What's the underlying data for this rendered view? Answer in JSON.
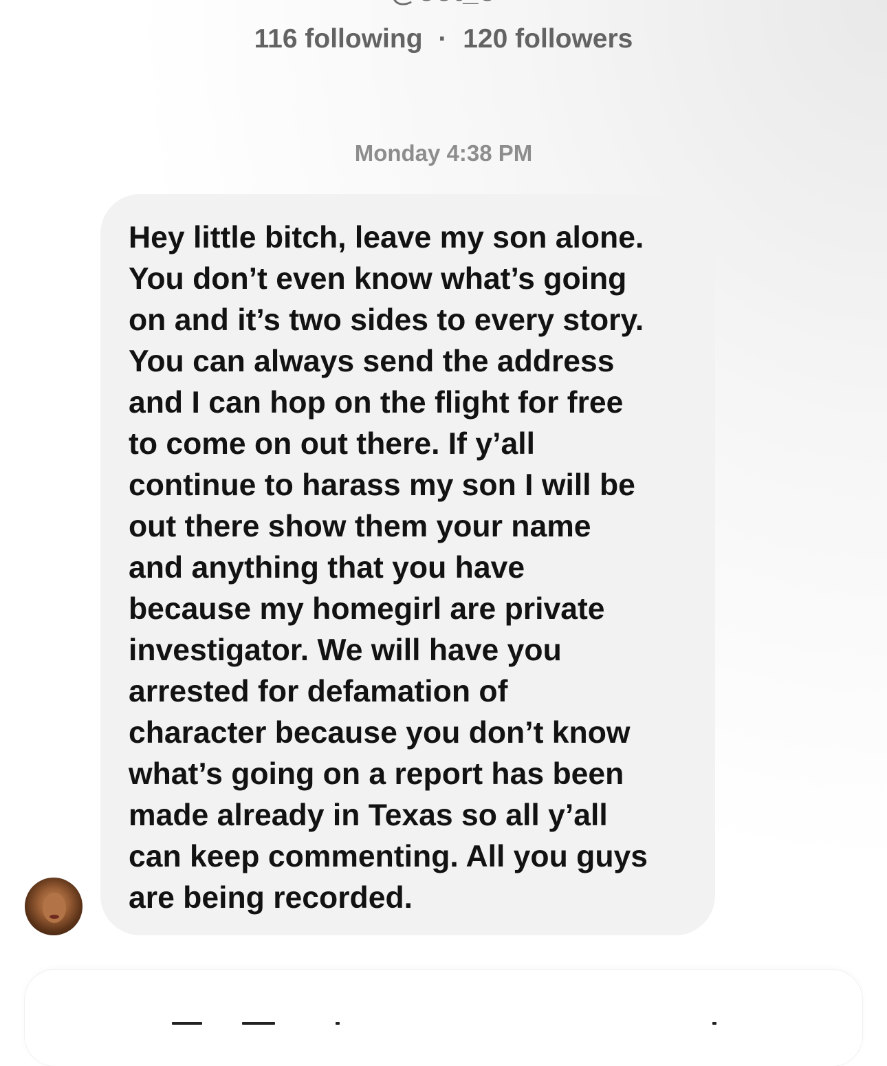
{
  "profile": {
    "handle": "@oot_o",
    "following_count": "116",
    "following_label": "following",
    "separator": "·",
    "followers_count": "120",
    "followers_label": "followers"
  },
  "thread": {
    "timestamp": "Monday 4:38 PM",
    "messages": [
      {
        "sender": "other",
        "avatar_icon": "user-avatar-photo",
        "text": "Hey little bitch, leave my son alone.\nYou don’t even know what’s going\non and it’s two sides to every story.\nYou can always send the address\nand I can hop on the flight for free\nto come on out there. If y’all\ncontinue to harass my son I will be\nout there show them your name\nand anything that you have\nbecause my homegirl are private\ninvestigator. We will have you\narrested for defamation of\ncharacter because you don’t know\nwhat’s going on a report has been\nmade already in Texas so all y’all\ncan keep commenting. All you guys\nare being recorded."
      }
    ]
  },
  "colors": {
    "bubble_background": "#f2f2f2",
    "message_text": "#121212",
    "meta_text": "#8d8d8d",
    "stats_text": "#636363"
  }
}
